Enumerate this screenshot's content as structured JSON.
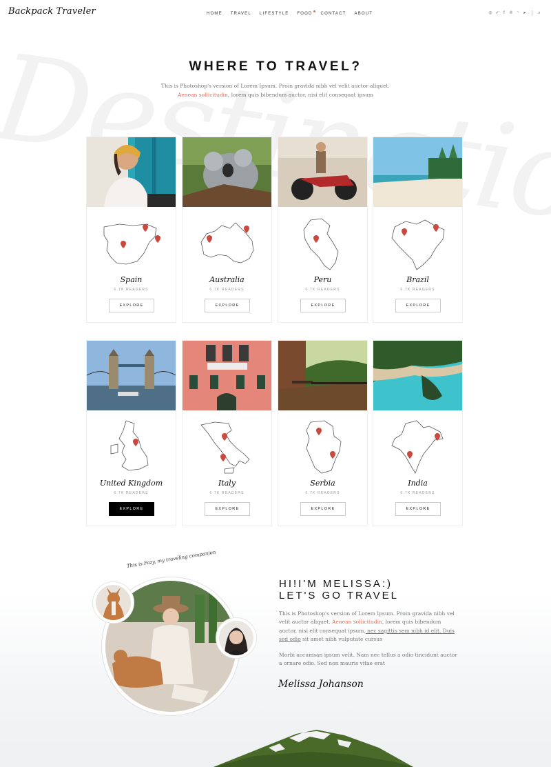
{
  "header": {
    "logo": "Backpack Traveler",
    "nav": [
      "HOME",
      "TRAVEL",
      "LIFESTYLE",
      "FOOD",
      "CONTACT",
      "ABOUT"
    ],
    "social": [
      "instagram-icon",
      "twitter-icon",
      "facebook-icon",
      "pinterest-icon",
      "rss-icon",
      "youtube-icon"
    ]
  },
  "watermark": "Destinations",
  "section": {
    "title": "WHERE TO TRAVEL?",
    "desc_1": "This is Photoshop's version  of Lorem Ipsum. Proin gravida nibh vel velit auctor aliquet.",
    "desc_2_link": "Aenean sollicitudin",
    "desc_2_rest": ", lorem quis bibendum auctor, nisi elit consequat ipsum"
  },
  "destinations": [
    {
      "name": "Spain",
      "readers": "6.7K READERS",
      "button": "EXPLORE",
      "active": false
    },
    {
      "name": "Australia",
      "readers": "6.7K READERS",
      "button": "EXPLORE",
      "active": false
    },
    {
      "name": "Peru",
      "readers": "6.7K READERS",
      "button": "EXPLORE",
      "active": false
    },
    {
      "name": "Brazil",
      "readers": "6.7K READERS",
      "button": "EXPLORE",
      "active": false
    },
    {
      "name": "United Kingdom",
      "readers": "6.7K READERS",
      "button": "EXPLORE",
      "active": true
    },
    {
      "name": "Italy",
      "readers": "6.7K READERS",
      "button": "EXPLORE",
      "active": false
    },
    {
      "name": "Serbia",
      "readers": "6.7K READERS",
      "button": "EXPLORE",
      "active": false
    },
    {
      "name": "India",
      "readers": "6.7K READERS",
      "button": "EXPLORE",
      "active": false
    }
  ],
  "about": {
    "caption": "This is Fazy, my traveling companion",
    "title_1": "HI!I'M MELISSA:)",
    "title_2": "LET'S GO TRAVEL",
    "p1_a": "This is Photoshop's version  of Lorem Ipsum. Proin gravida nibh vel velit auctor aliquet. ",
    "p1_link": "Aenean sollicitudin",
    "p1_b": ", lorem quis bibendum auctor, nisi elit consequat ipsum,",
    "p1_under": " nec sagittis sem nibh id elit. Duis sed odio",
    "p1_c": " sit amet nibh vulputate cursus",
    "p2": "Morbi accumsan ipsum velit. Nam nec tellus a odio tincidunt auctor a ornare odio. Sed non  mauris vitae erat",
    "signature": "Melissa Johanson"
  },
  "colors": {
    "accent": "#e76b55",
    "pin": "#c9493f"
  }
}
